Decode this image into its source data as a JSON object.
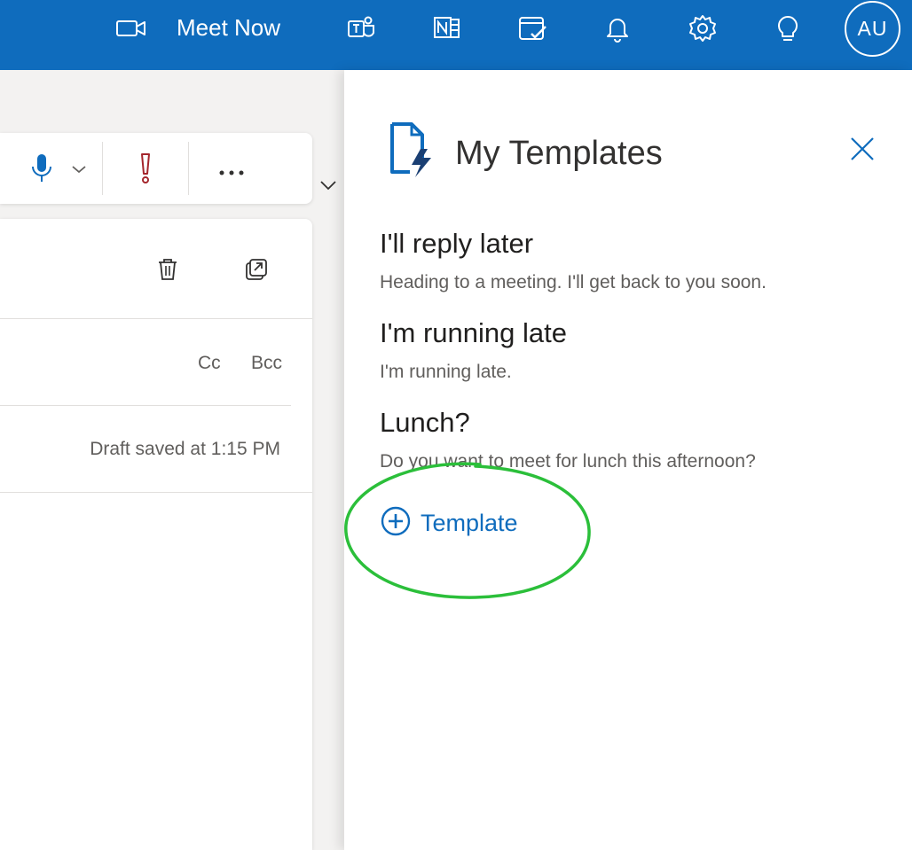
{
  "topbar": {
    "meet_now_label": "Meet Now",
    "avatar_initials": "AU",
    "icons": [
      "video-camera-icon",
      "teams-icon",
      "onenote-icon",
      "todo-icon",
      "bell-icon",
      "gear-icon",
      "lightbulb-icon"
    ],
    "color": "#0f6cbd"
  },
  "compose": {
    "cc_label": "Cc",
    "bcc_label": "Bcc",
    "draft_status": "Draft saved at 1:15 PM",
    "toolbar_icons": [
      "microphone-icon",
      "chevron-down-icon",
      "importance-icon",
      "more-icon"
    ]
  },
  "templates_panel": {
    "title": "My Templates",
    "templates": [
      {
        "title": "I'll reply later",
        "body": "Heading to a meeting. I'll get back to you soon."
      },
      {
        "title": "I'm running late",
        "body": "I'm running late."
      },
      {
        "title": "Lunch?",
        "body": "Do you want to meet for lunch this afternoon?"
      }
    ],
    "add_label": "Template",
    "accent": "#0f6cbd",
    "highlight_color": "#2bbf3a"
  }
}
